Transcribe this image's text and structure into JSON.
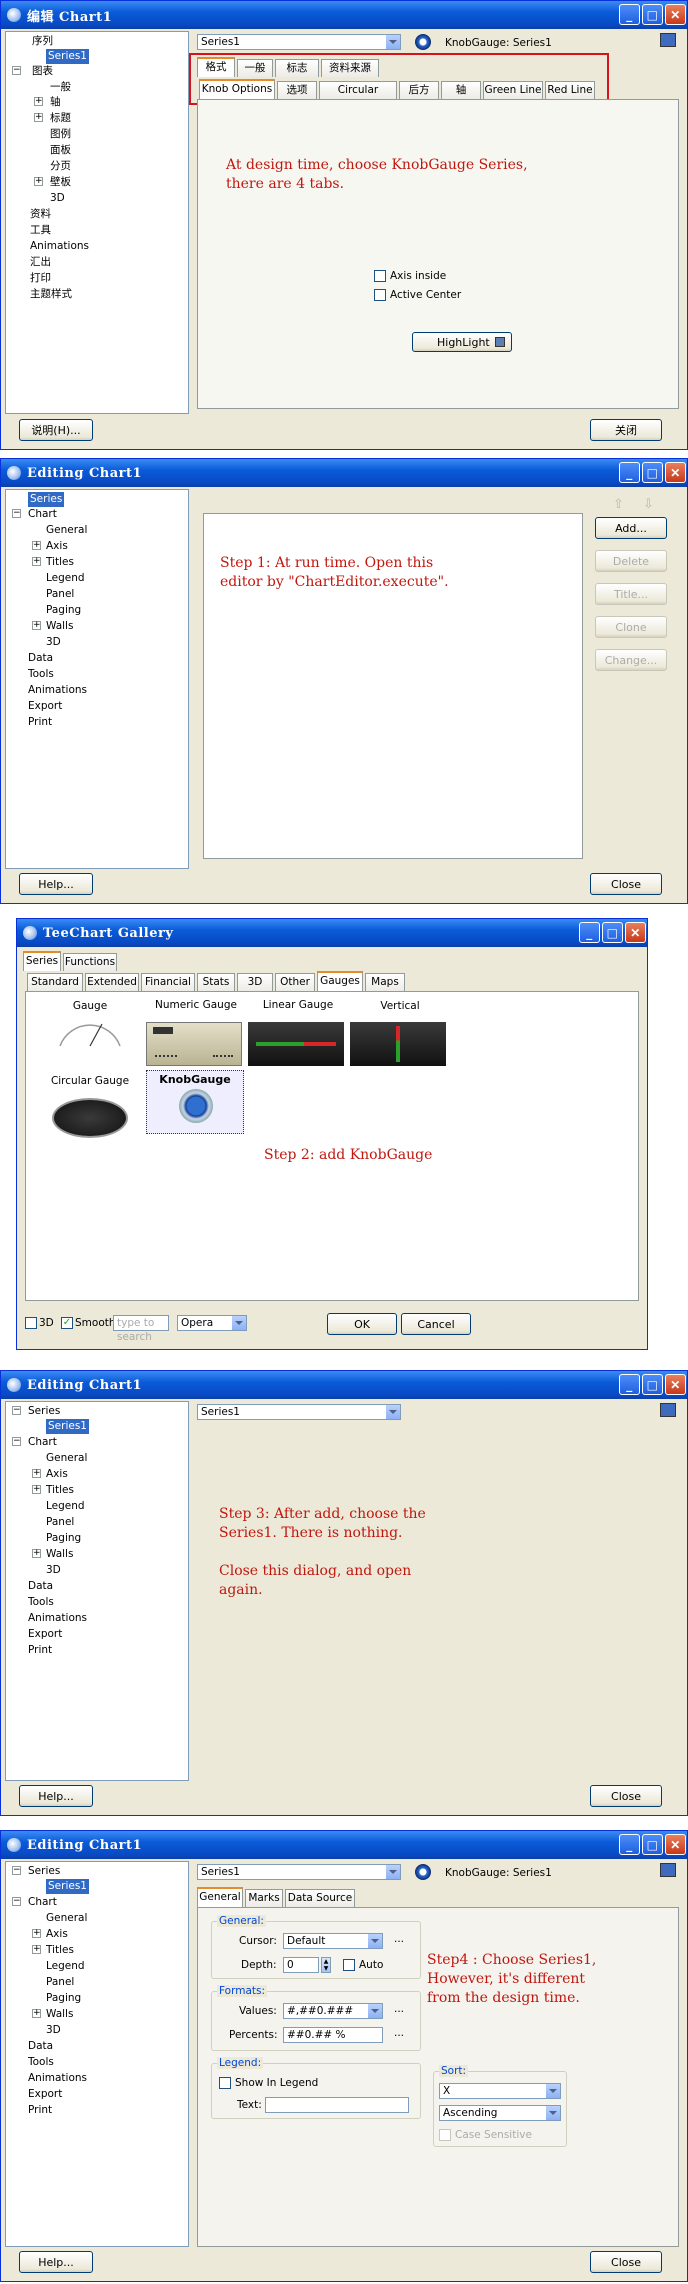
{
  "w1": {
    "title": "编辑 Chart1",
    "tree": [
      "序列",
      "Series1",
      "图表",
      "一般",
      "轴",
      "标题",
      "图例",
      "面板",
      "分页",
      "壁板",
      "3D",
      "资料",
      "工具",
      "Animations",
      "汇出",
      "打印",
      "主题样式"
    ],
    "series": "Series1",
    "gauge": "KnobGauge: Series1",
    "tabs": [
      "格式",
      "一般",
      "标志",
      "资料来源"
    ],
    "subtabs": [
      "Knob Options",
      "选项",
      "Circular Frame",
      "后方",
      "轴",
      "Green Line",
      "Red Line"
    ],
    "note": "At design time, choose KnobGauge Series,\nthere are 4 tabs.",
    "axis_inside": "Axis inside",
    "active_center": "Active Center",
    "highlight": "HighLight",
    "help": "说明(H)...",
    "close": "关闭"
  },
  "w2": {
    "title": "Editing Chart1",
    "tree": [
      "Series",
      "Chart",
      "General",
      "Axis",
      "Titles",
      "Legend",
      "Panel",
      "Paging",
      "Walls",
      "3D",
      "Data",
      "Tools",
      "Animations",
      "Export",
      "Print"
    ],
    "note": "Step 1: At  run  time. Open this\neditor by \"ChartEditor.execute\".",
    "buttons": [
      "Add...",
      "Delete",
      "Title...",
      "Clone",
      "Change..."
    ],
    "help": "Help...",
    "close": "Close"
  },
  "w3": {
    "title": "TeeChart Gallery",
    "tabs": [
      "Series",
      "Functions"
    ],
    "subtabs": [
      "Standard",
      "Extended",
      "Financial",
      "Stats",
      "3D",
      "Other",
      "Gauges",
      "Maps"
    ],
    "items": [
      "Gauge",
      "Numeric Gauge",
      "Linear Gauge",
      "Vertical",
      "Circular Gauge",
      "KnobGauge"
    ],
    "note": "Step 2: add KnobGauge",
    "chk3d": "3D",
    "smooth": "Smooth",
    "search": "type to search",
    "theme": "Opera",
    "ok": "OK",
    "cancel": "Cancel"
  },
  "w4": {
    "title": "Editing Chart1",
    "tree": [
      "Series",
      "Series1",
      "Chart",
      "General",
      "Axis",
      "Titles",
      "Legend",
      "Panel",
      "Paging",
      "Walls",
      "3D",
      "Data",
      "Tools",
      "Animations",
      "Export",
      "Print"
    ],
    "series": "Series1",
    "note": "Step 3: After add, choose the\nSeries1. There is nothing.\n\nClose this dialog, and open\nagain.",
    "help": "Help...",
    "close": "Close"
  },
  "w5": {
    "title": "Editing Chart1",
    "tree": [
      "Series",
      "Series1",
      "Chart",
      "General",
      "Axis",
      "Titles",
      "Legend",
      "Panel",
      "Paging",
      "Walls",
      "3D",
      "Data",
      "Tools",
      "Animations",
      "Export",
      "Print"
    ],
    "series": "Series1",
    "gauge": "KnobGauge: Series1",
    "tabs": [
      "General",
      "Marks",
      "Data Source"
    ],
    "general": "General:",
    "cursor": "Cursor:",
    "cursor_val": "Default",
    "depth": "Depth:",
    "depth_val": "0",
    "auto": "Auto",
    "formats": "Formats:",
    "values": "Values:",
    "values_val": "#,##0.###",
    "percents": "Percents:",
    "percents_val": "##0.## %",
    "legend": "Legend:",
    "show_legend": "Show In Legend",
    "text": "Text:",
    "sort": "Sort:",
    "sort_val": "X",
    "order": "Ascending",
    "case": "Case Sensitive",
    "note": "Step4 : Choose Series1,\nHowever, it's different\nfrom the design time.",
    "help": "Help...",
    "close": "Close"
  },
  "colors": {
    "note": "#c0170f",
    "accent": "#e68b2c",
    "highlight_box": "#d4141a"
  }
}
